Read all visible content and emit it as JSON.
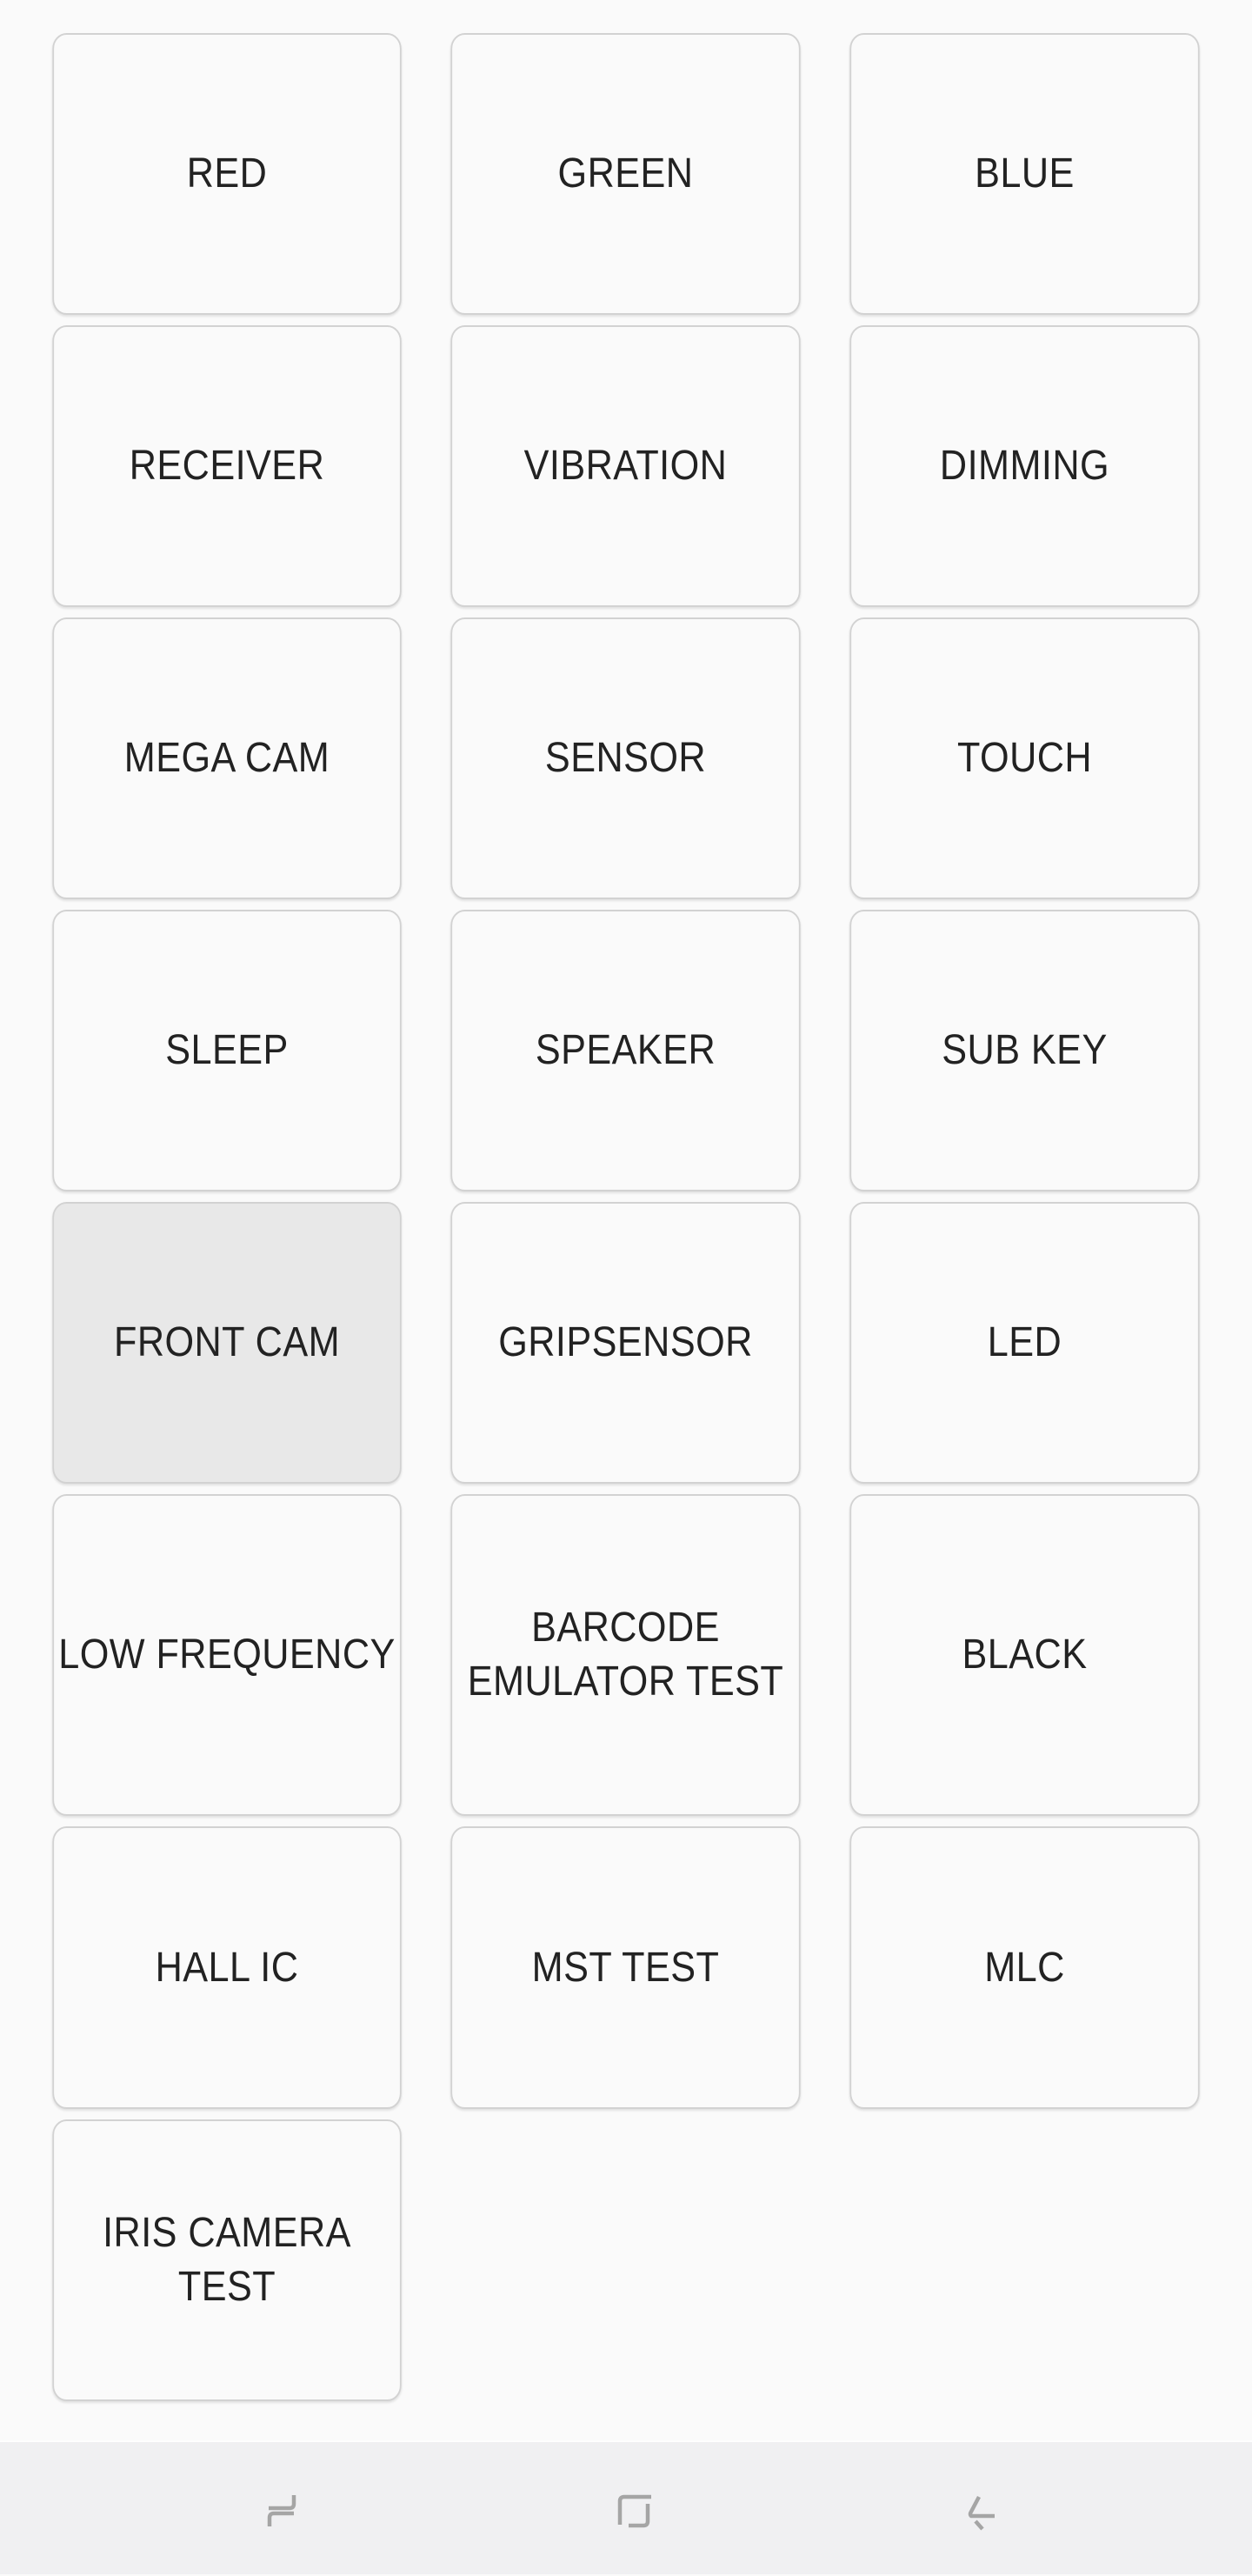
{
  "tests": [
    {
      "label": "RED"
    },
    {
      "label": "GREEN"
    },
    {
      "label": "BLUE"
    },
    {
      "label": "RECEIVER"
    },
    {
      "label": "VIBRATION"
    },
    {
      "label": "DIMMING"
    },
    {
      "label": "MEGA CAM"
    },
    {
      "label": "SENSOR"
    },
    {
      "label": "TOUCH"
    },
    {
      "label": "SLEEP"
    },
    {
      "label": "SPEAKER"
    },
    {
      "label": "SUB KEY"
    },
    {
      "label": "FRONT CAM",
      "pressed": true
    },
    {
      "label": "GRIPSENSOR"
    },
    {
      "label": "LED"
    },
    {
      "label": "LOW FREQUENCY"
    },
    {
      "label": "BARCODE\nEMULATOR TEST"
    },
    {
      "label": "BLACK"
    },
    {
      "label": "HALL IC"
    },
    {
      "label": "MST TEST"
    },
    {
      "label": "MLC"
    },
    {
      "label": "IRIS CAMERA TEST"
    }
  ],
  "navbar": {
    "recents": "recent-apps-icon",
    "home": "home-icon",
    "back": "back-icon"
  },
  "colors": {
    "background": "#fafafa",
    "tile_border": "#d2d2d2",
    "tile_pressed": "#e8e8e8",
    "text": "#222222",
    "navbar_bg": "#f0f0f2",
    "nav_icon": "#a5a5a5"
  }
}
